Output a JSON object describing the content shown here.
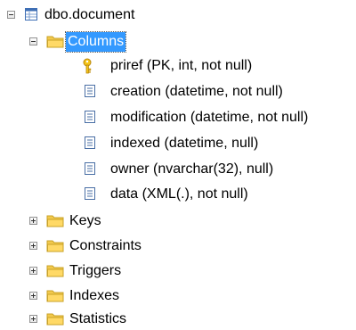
{
  "tree": {
    "root": {
      "label": "dbo.document",
      "icon": "table-icon",
      "expanded": true
    },
    "columns_folder": {
      "label": "Columns",
      "icon": "folder-icon",
      "expanded": true,
      "selected": true
    },
    "columns": [
      {
        "label": "priref (PK, int, not null)",
        "icon": "key-icon"
      },
      {
        "label": "creation (datetime, not null)",
        "icon": "column-icon"
      },
      {
        "label": "modification (datetime, not null)",
        "icon": "column-icon"
      },
      {
        "label": "indexed (datetime, null)",
        "icon": "column-icon"
      },
      {
        "label": "owner (nvarchar(32), null)",
        "icon": "column-icon"
      },
      {
        "label": "data (XML(.), not null)",
        "icon": "column-icon"
      }
    ],
    "folders": [
      {
        "label": "Keys",
        "icon": "folder-icon",
        "expanded": false
      },
      {
        "label": "Constraints",
        "icon": "folder-icon",
        "expanded": false
      },
      {
        "label": "Triggers",
        "icon": "folder-icon",
        "expanded": false
      },
      {
        "label": "Indexes",
        "icon": "folder-icon",
        "expanded": false
      },
      {
        "label": "Statistics",
        "icon": "folder-icon",
        "expanded": false
      }
    ],
    "colors": {
      "selection": "#3399ff",
      "folder": "#f2c94c",
      "table_blue": "#3f6fb5",
      "key_gold": "#e0a800"
    }
  }
}
